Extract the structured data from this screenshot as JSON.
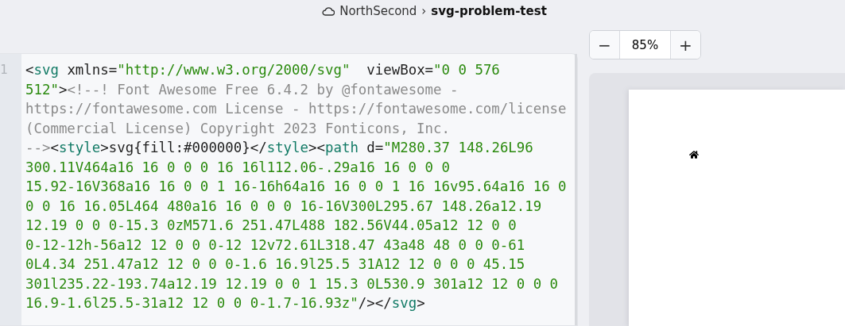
{
  "breadcrumb": {
    "workspace": "NorthSecond",
    "separator": "›",
    "project": "svg-problem-test"
  },
  "zoom": {
    "minus": "−",
    "value": "85%",
    "plus": "+"
  },
  "editor": {
    "line_number": "1",
    "rows": [
      "<svg xmlns=\"http://www.w3.org/2000/svg\"  viewBox=\"0 0 576",
      "512\"><!--! Font Awesome Free 6.4.2 by @fontawesome -",
      "https://fontawesome.com License - https://fontawesome.com/license",
      "(Commercial License) Copyright 2023 Fonticons, Inc.",
      "--><style>svg{fill:#000000}</style><path d=\"M280.37 148.26L96",
      "300.11V464a16 16 0 0 0 16 16l112.06-.29a16 16 0 0 0",
      "15.92-16V368a16 16 0 0 1 16-16h64a16 16 0 0 1 16 16v95.64a16 16 0",
      "0 0 16 16.05L464 480a16 16 0 0 0 16-16V300L295.67 148.26a12.19",
      "12.19 0 0 0-15.3 0zM571.6 251.47L488 182.56V44.05a12 12 0 0",
      "0-12-12h-56a12 12 0 0 0-12 12v72.61L318.47 43a48 48 0 0 0-61",
      "0L4.34 251.47a12 12 0 0 0-1.6 16.9l25.5 31A12 12 0 0 0 45.15",
      "301l235.22-193.74a12.19 12.19 0 0 1 15.3 0L530.9 301a12 12 0 0 0",
      "16.9-1.6l25.5-31a12 12 0 0 0-1.7-16.93z\"/></svg>"
    ]
  }
}
